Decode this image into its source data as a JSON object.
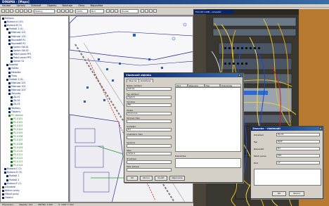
{
  "window": {
    "title": "DINAMA - [Mapa]"
  },
  "menu": [
    "Soubor",
    "Úpravy",
    "Zobrazit",
    "Objekty",
    "Nástroje",
    "Okno",
    "Nápověda"
  ],
  "toolbar": {
    "layer_label": "Moduly",
    "view_label": "Bod",
    "search_label": "Hledat",
    "zoom_label": "100%"
  },
  "tree": {
    "items": [
      {
        "label": "Kampus",
        "color": "#0a246a"
      },
      {
        "label": "Budova A (10)",
        "color": "#0a246a"
      },
      {
        "label": "Budova B (3)",
        "color": "#0a246a"
      },
      {
        "label": "Podlaží 1 (4)",
        "color": "#0a246a"
      },
      {
        "label": "Místnost 101",
        "color": "#0a246a"
      },
      {
        "label": "Místnost 102",
        "color": "#0a246a"
      },
      {
        "label": "Rozvaděč R1",
        "color": "#0a246a"
      },
      {
        "label": "Rozvaděč R2",
        "color": "#0a246a"
      },
      {
        "label": "Switch SW-01",
        "color": "#0a246a"
      },
      {
        "label": "Switch SW-02",
        "color": "#0a246a"
      },
      {
        "label": "Patch panel PP1",
        "color": "#0a246a"
      },
      {
        "label": "Patch panel PP2",
        "color": "#0a246a"
      },
      {
        "label": "Server S1",
        "color": "#0a246a"
      },
      {
        "label": "Kabeláž",
        "color": "#0a246a"
      },
      {
        "label": "Optika",
        "color": "#0a246a"
      },
      {
        "label": "Metalika",
        "color": "#0a246a"
      },
      {
        "label": "Trasy",
        "color": "#0a246a"
      },
      {
        "label": "Podlaží 2 (6)",
        "color": "#0a246a"
      },
      {
        "label": "Místnost 201",
        "color": "#0a246a"
      },
      {
        "label": "Místnost 202",
        "color": "#0a246a"
      },
      {
        "label": "Místnost 203",
        "color": "#0a246a"
      },
      {
        "label": "Zásuvky",
        "color": "#0a246a"
      },
      {
        "label": "ZA-01",
        "color": "#0a246a"
      },
      {
        "label": "ZA-02",
        "color": "#0a246a"
      },
      {
        "label": "ZA-03",
        "color": "#0a246a"
      },
      {
        "label": "Telefony",
        "color": "#0a246a"
      },
      {
        "label": "Tiskárny",
        "color": "#0a246a"
      },
      {
        "label": "PC stanice",
        "color": "#1a7a1a"
      },
      {
        "label": "PC-0101",
        "color": "#1a7a1a"
      },
      {
        "label": "PC-0102",
        "color": "#1a7a1a"
      },
      {
        "label": "PC-0103",
        "color": "#1a7a1a"
      },
      {
        "label": "PC-0104",
        "color": "#1a7a1a"
      },
      {
        "label": "PC-0105",
        "color": "#1a7a1a"
      },
      {
        "label": "PC-0106",
        "color": "#1a7a1a"
      },
      {
        "label": "PC-0107",
        "color": "#1a7a1a"
      },
      {
        "label": "PC-0108",
        "color": "#1a7a1a"
      },
      {
        "label": "PC-0109",
        "color": "#1a7a1a"
      },
      {
        "label": "PC-0110",
        "color": "#1a7a1a"
      },
      {
        "label": "PC-0111",
        "color": "#1a7a1a"
      },
      {
        "label": "PC-0112",
        "color": "#1a7a1a"
      },
      {
        "label": "PC-0113",
        "color": "#1a7a1a"
      },
      {
        "label": "PC-0114",
        "color": "#1a7a1a"
      },
      {
        "label": "Budova C (2)",
        "color": "#0a246a"
      },
      {
        "label": "Budova D (5)",
        "color": "#0a246a"
      },
      {
        "label": "Podlaží 1",
        "color": "#0a246a"
      },
      {
        "label": "Podlaží 2",
        "color": "#0a246a"
      },
      {
        "label": "Budova E (1)",
        "color": "#0a246a"
      },
      {
        "label": "Uživatelé",
        "color": "#0a246a"
      },
      {
        "label": "Aktivní prvky",
        "color": "#0a246a"
      },
      {
        "label": "Síťové prvky",
        "color": "#0a246a"
      },
      {
        "label": "Ostatní",
        "color": "#0a246a"
      }
    ]
  },
  "photo": {
    "caption": "Foto RP 110B - rozvaděč"
  },
  "dialog_main": {
    "title": "Vlastnosti objektu",
    "tabs": [
      "Obecné",
      "Rozšířené"
    ],
    "fields": [
      {
        "label": "Název zařízení",
        "value": "SW-01"
      },
      {
        "label": "Typ zařízení",
        "value": "Switch"
      },
      {
        "label": "Výrobce",
        "value": "HP"
      },
      {
        "label": "Model",
        "value": "ProCurve"
      },
      {
        "label": "Sériové číslo",
        "value": ""
      },
      {
        "label": "Umístění",
        "value": "R1"
      },
      {
        "label": "Inventární číslo",
        "value": ""
      },
      {
        "label": "Správce",
        "value": ""
      },
      {
        "label": "Stav",
        "value": "Aktivní"
      },
      {
        "label": "IP adresa",
        "value": ""
      },
      {
        "label": "MAC adresa",
        "value": ""
      }
    ],
    "ports_header": [
      "Port",
      "Zásuvka",
      "Typ",
      "Poznámka"
    ],
    "note_label": "Poznámka",
    "buttons": [
      "OK",
      "Storno",
      "Použít",
      "Nápověda"
    ]
  },
  "dialog_sub": {
    "title": "Zásuvka - vlastnosti",
    "fields": [
      {
        "label": "Označení",
        "value": "ZA-01"
      },
      {
        "label": "Typ",
        "value": "RJ45"
      },
      {
        "label": "Rozvaděč",
        "value": "R1"
      },
      {
        "label": "Patch panel",
        "value": "PP1"
      },
      {
        "label": "Port",
        "value": "12"
      }
    ],
    "buttons": [
      "OK",
      "Storno"
    ]
  },
  "status": [
    "Připraveno",
    "Objekty: 124",
    "Měřítko 1:200",
    "X: 1024 Y: 512"
  ]
}
